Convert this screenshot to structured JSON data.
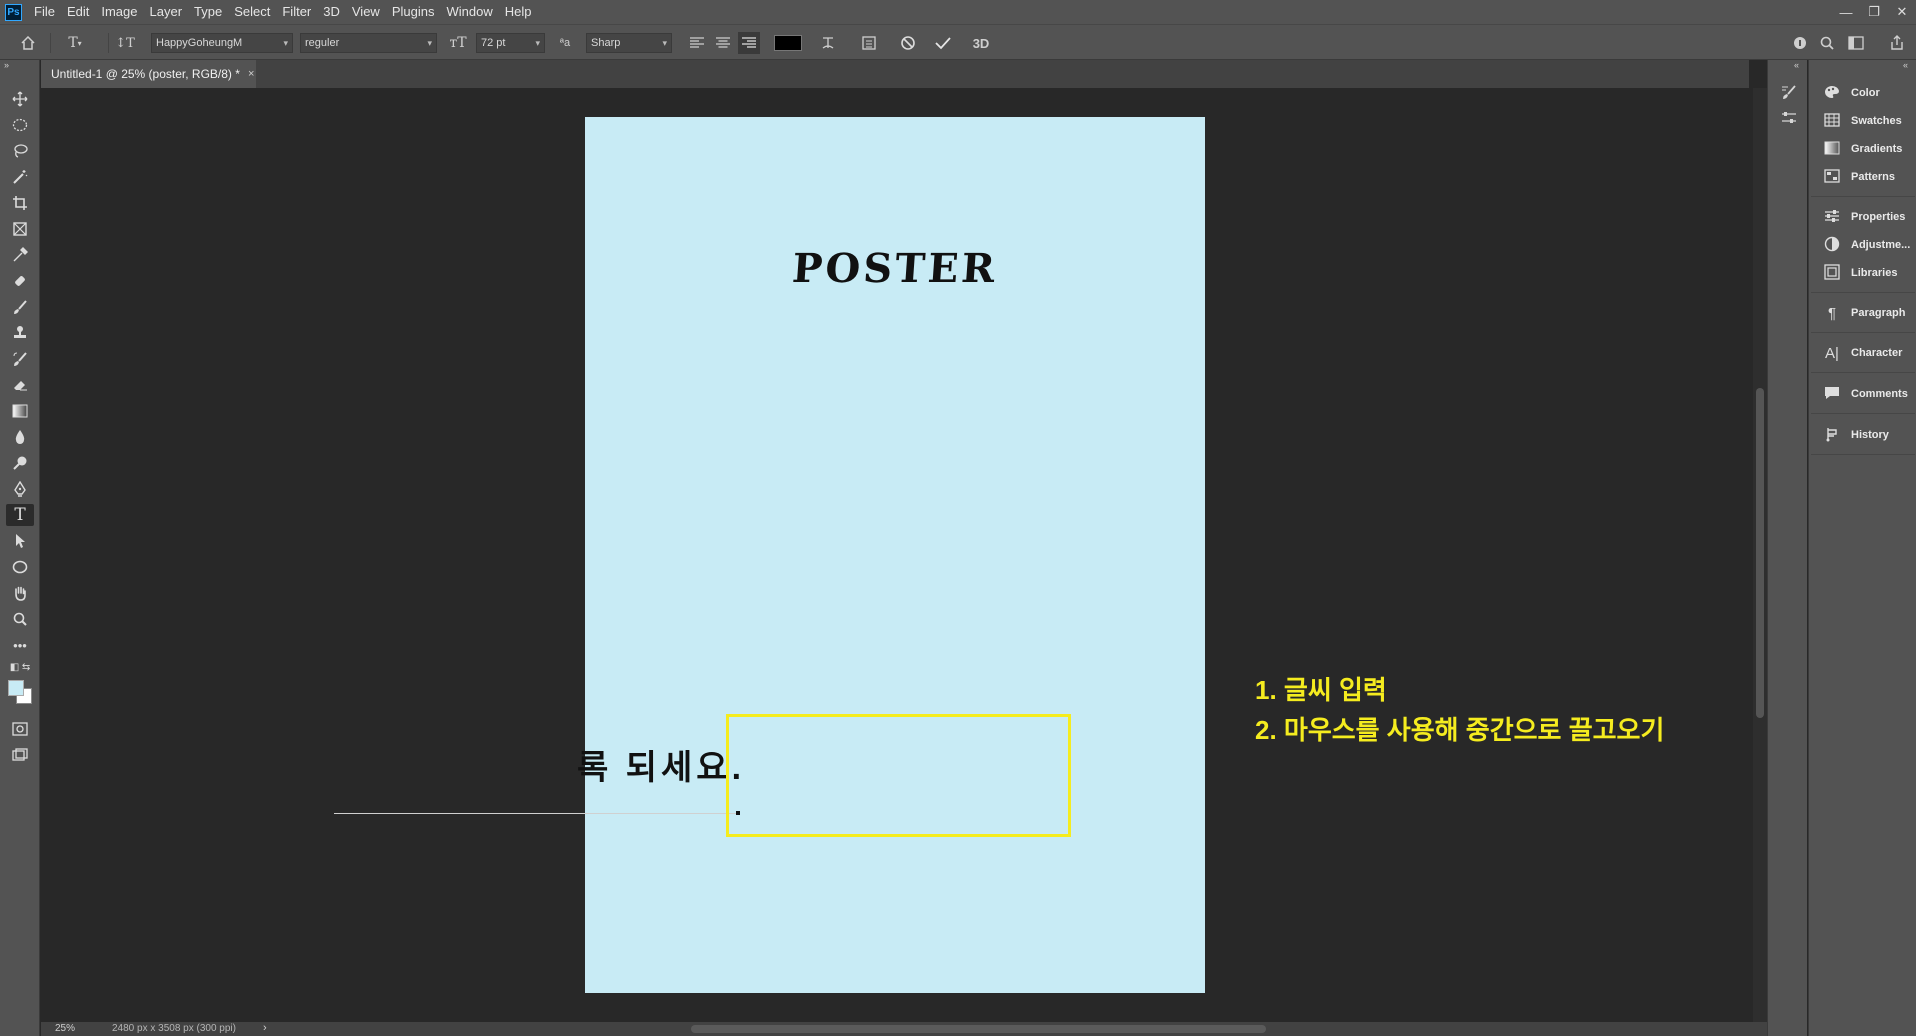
{
  "app": {
    "logo": "Ps"
  },
  "menu": [
    "File",
    "Edit",
    "Image",
    "Layer",
    "Type",
    "Select",
    "Filter",
    "3D",
    "View",
    "Plugins",
    "Window",
    "Help"
  ],
  "window_controls": {
    "minimize": "—",
    "restore": "❐",
    "close": "✕"
  },
  "options_bar": {
    "font_family": "HappyGoheungM",
    "font_style": "reguler",
    "font_size": "72 pt",
    "antialias": "Sharp",
    "three_d_label": "3D",
    "text_color": "#000000"
  },
  "document": {
    "tab_title": "Untitled-1 @ 25% (poster, RGB/8) *",
    "tab_close": "×"
  },
  "canvas": {
    "page_color": "#c8ebf5",
    "poster_title": "POSTER",
    "floating_text": "록 되세요.",
    "note_line1": "1. 글씨 입력",
    "note_line2": "2. 마우스를 사용해 중간으로 끌고오기",
    "highlight_color": "#f5ec1f"
  },
  "status": {
    "zoom": "25%",
    "doc_size": "2480 px x 3508 px (300 ppi)",
    "arrow": "›"
  },
  "tools": [
    "move-icon",
    "marquee-icon",
    "lasso-icon",
    "magic-wand-icon",
    "crop-icon",
    "frame-icon",
    "eyedropper-icon",
    "healing-icon",
    "brush-icon",
    "stamp-icon",
    "history-brush-icon",
    "eraser-icon",
    "gradient-icon",
    "blur-icon",
    "dodge-icon",
    "pen-icon",
    "type-icon",
    "path-select-icon",
    "ellipse-icon",
    "hand-icon",
    "zoom-icon",
    "more-icon"
  ],
  "colors": {
    "foreground": "#c8ebf5",
    "background": "#ffffff"
  },
  "panels": [
    {
      "label": "Color",
      "icon": "color-icon"
    },
    {
      "label": "Swatches",
      "icon": "swatches-icon"
    },
    {
      "label": "Gradients",
      "icon": "gradients-icon"
    },
    {
      "label": "Patterns",
      "icon": "patterns-icon"
    },
    {
      "label": "Properties",
      "icon": "properties-icon"
    },
    {
      "label": "Adjustme...",
      "icon": "adjustments-icon"
    },
    {
      "label": "Libraries",
      "icon": "libraries-icon"
    },
    {
      "label": "Paragraph",
      "icon": "paragraph-icon"
    },
    {
      "label": "Character",
      "icon": "character-icon"
    },
    {
      "label": "Comments",
      "icon": "comments-icon"
    },
    {
      "label": "History",
      "icon": "history-icon"
    }
  ]
}
